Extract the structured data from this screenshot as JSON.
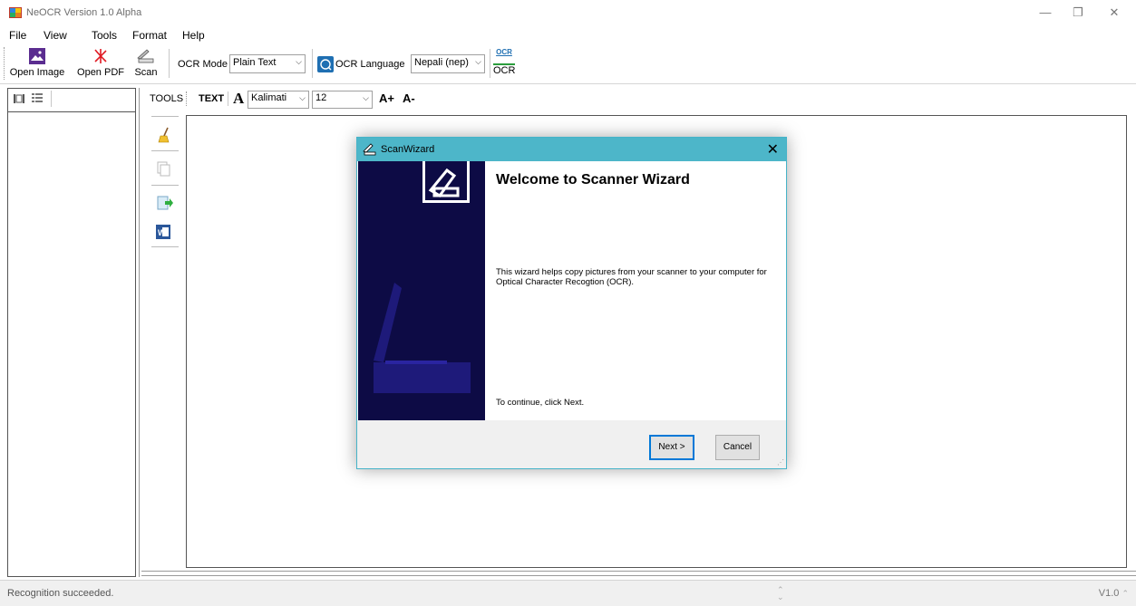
{
  "window": {
    "title": "NeOCR Version 1.0 Alpha",
    "minimize": "—",
    "restore": "❐",
    "close": "✕"
  },
  "menu": [
    "File",
    "View",
    "Tools",
    "Format",
    "Help"
  ],
  "toolbar": {
    "open_image": "Open Image",
    "open_pdf": "Open PDF",
    "scan": "Scan",
    "ocr_mode_label": "OCR Mode",
    "ocr_mode_value": "Plain Text",
    "ocr_language_label": "OCR Language",
    "ocr_language_value": "Nepali (nep)",
    "ocr_icon_text": "OCR",
    "ocr_label": "OCR"
  },
  "text_toolbar": {
    "tools_label": "TOOLS",
    "text_label": "TEXT",
    "font_glyph": "A",
    "font_value": "Kalimati",
    "size_value": "12",
    "increase": "A+",
    "decrease": "A-"
  },
  "dialog": {
    "title": "ScanWizard",
    "close": "✕",
    "heading": "Welcome to Scanner Wizard",
    "description": "This wizard helps copy pictures from your scanner to your computer for Optical Character Recogtion (OCR).",
    "continue_text": "To continue, click Next.",
    "next_button": "Next >",
    "cancel_button": "Cancel"
  },
  "status": {
    "message": "Recognition succeeded.",
    "version": "V1.0"
  },
  "colors": {
    "accent": "#4db6c9",
    "wizard_side": "#0d0b45",
    "primary_border": "#0078d7"
  }
}
